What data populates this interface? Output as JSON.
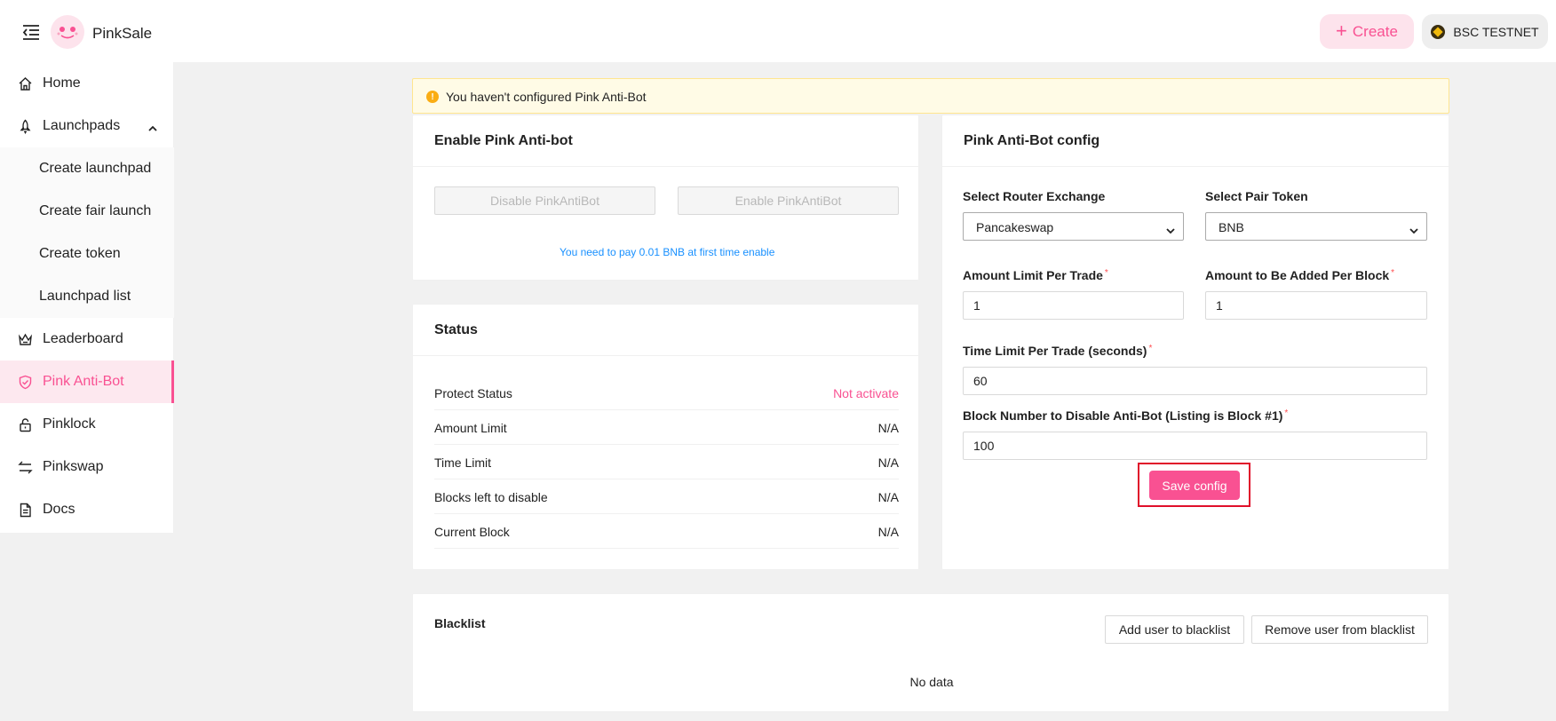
{
  "header": {
    "brand": "PinkSale",
    "create_label": "Create",
    "create_icon": "+",
    "network_label": "BSC TESTNET"
  },
  "sidebar": {
    "items": [
      {
        "label": "Home",
        "icon": "home-icon"
      },
      {
        "label": "Launchpads",
        "icon": "rocket-icon"
      },
      {
        "label": "Create launchpad"
      },
      {
        "label": "Create fair launch"
      },
      {
        "label": "Create token"
      },
      {
        "label": "Launchpad list"
      },
      {
        "label": "Leaderboard",
        "icon": "crown-icon"
      },
      {
        "label": "Pink Anti-Bot",
        "icon": "shield-icon",
        "active": true
      },
      {
        "label": "Pinklock",
        "icon": "lock-icon"
      },
      {
        "label": "Pinkswap",
        "icon": "swap-icon"
      },
      {
        "label": "Docs",
        "icon": "document-icon"
      }
    ]
  },
  "alert": {
    "icon": "!",
    "text": "You haven't configured Pink Anti-Bot"
  },
  "enable_card": {
    "title": "Enable Pink Anti-bot",
    "disable_label": "Disable PinkAntiBot",
    "enable_label": "Enable PinkAntiBot",
    "hint": "You need to pay 0.01 BNB at first time enable"
  },
  "status_card": {
    "title": "Status",
    "rows": [
      {
        "key": "Protect Status",
        "value": "Not activate"
      },
      {
        "key": "Amount Limit",
        "value": "N/A"
      },
      {
        "key": "Time Limit",
        "value": "N/A"
      },
      {
        "key": "Blocks left to disable",
        "value": "N/A"
      },
      {
        "key": "Current Block",
        "value": "N/A"
      }
    ]
  },
  "config_card": {
    "title": "Pink Anti-Bot config",
    "router_label": "Select Router Exchange",
    "router_value": "Pancakeswap",
    "pair_label": "Select Pair Token",
    "pair_value": "BNB",
    "amount_limit_label": "Amount Limit Per Trade",
    "amount_limit_value": "1",
    "amount_added_label": "Amount to Be Added Per Block",
    "amount_added_value": "1",
    "time_limit_label": "Time Limit Per Trade (seconds)",
    "time_limit_value": "60",
    "block_number_label": "Block Number to Disable Anti-Bot (Listing is Block #1)",
    "block_number_value": "100",
    "required_mark": "*",
    "save_label": "Save config"
  },
  "blacklist_card": {
    "title": "Blacklist",
    "add_label": "Add user to blacklist",
    "remove_label": "Remove user from blacklist",
    "empty_text": "No data"
  },
  "colors": {
    "accent": "#f95192",
    "accent_light": "#fde3ec",
    "warning_bg": "#fffbe6",
    "warning_icon": "#faad14",
    "link": "#1890ff",
    "highlight_box": "#e0102a"
  }
}
